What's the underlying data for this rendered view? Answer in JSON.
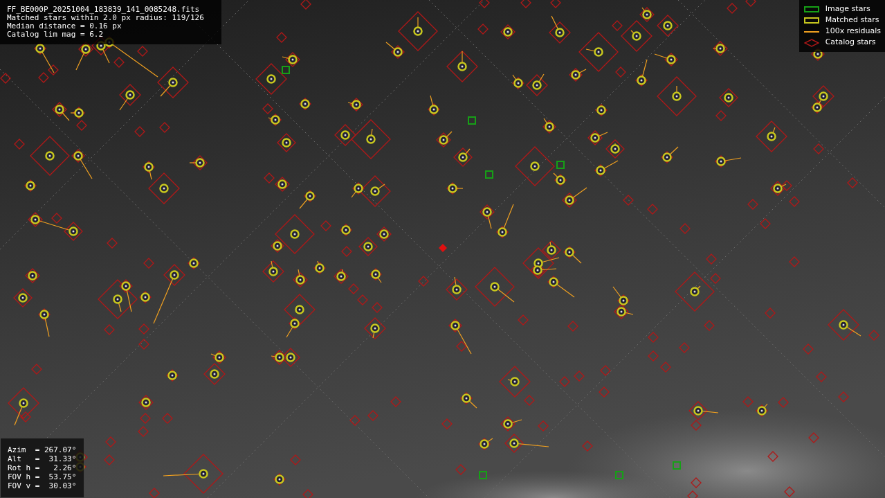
{
  "header": {
    "lines": [
      "FF_BE000P_20251004_183839_141_0085248.fits",
      "Matched stars within 2.0 px radius: 119/126",
      "Median distance = 0.16 px",
      "Catalog lim mag = 6.2"
    ]
  },
  "legend": [
    {
      "kind": "image",
      "label": "Image stars"
    },
    {
      "kind": "matched",
      "label": "Matched stars"
    },
    {
      "kind": "residual",
      "label": "100x residuals"
    },
    {
      "kind": "catalog",
      "label": "Catalog stars"
    }
  ],
  "pointing": {
    "lines": [
      "Azim  = 267.07°",
      "Alt   =  31.33°",
      "Rot h =   2.26°",
      "FOV h =  53.75°",
      "FOV v =  30.03°"
    ]
  }
}
